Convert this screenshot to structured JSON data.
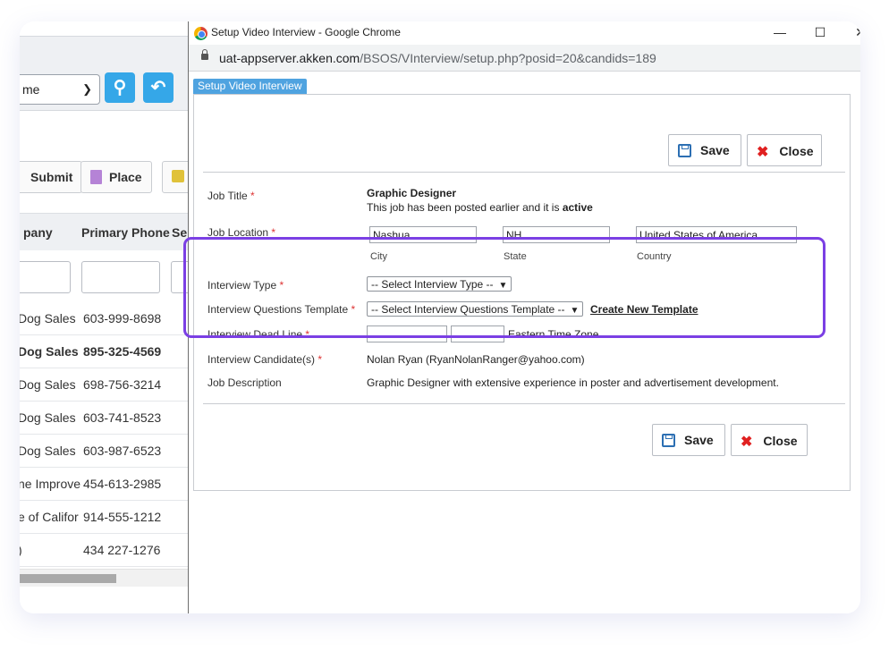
{
  "background_app": {
    "select_value": "me",
    "buttons": {
      "submit": "Submit",
      "place": "Place"
    },
    "columns": {
      "company": "pany",
      "primary_phone": "Primary Phone",
      "third": "Se"
    },
    "rows": [
      {
        "company": "Dog Sales",
        "phone": "603-999-8698",
        "bold": false
      },
      {
        "company": "Dog Sales",
        "phone": "895-325-4569",
        "bold": true
      },
      {
        "company": "Dog Sales",
        "phone": "698-756-3214",
        "bold": false
      },
      {
        "company": "Dog Sales",
        "phone": "603-741-8523",
        "bold": false
      },
      {
        "company": "Dog Sales",
        "phone": "603-987-6523",
        "bold": false
      },
      {
        "company": "ne Improve",
        "phone": "454-613-2985",
        "bold": false
      },
      {
        "company": "e of Califor",
        "phone": "914-555-1212",
        "bold": false
      },
      {
        "company": ")",
        "phone": "434 227-1276",
        "bold": false
      }
    ],
    "colors": {
      "icon_button": "#35a7e8"
    }
  },
  "window": {
    "title": "Setup Video Interview - Google Chrome",
    "controls": {
      "minimize": "—",
      "maximize": "☐",
      "close": "✕"
    },
    "url_host": "uat-appserver.akken.com",
    "url_path": "/BSOS/VInterview/setup.php?posid=20&candids=189"
  },
  "form": {
    "tab_label": "Setup Video Interview",
    "save_label": "Save",
    "close_label": "Close",
    "job_title": {
      "label": "Job Title",
      "value": "Graphic Designer",
      "note_prefix": "This job has been posted earlier and it is",
      "note_status": "active"
    },
    "job_location": {
      "label": "Job Location",
      "city": "Nashua",
      "state": "NH",
      "country": "United States of America",
      "city_label": "City",
      "state_label": "State",
      "country_label": "Country"
    },
    "interview_type": {
      "label": "Interview Type",
      "selected": "-- Select Interview Type --"
    },
    "questions_template": {
      "label": "Interview Questions Template",
      "selected": "-- Select Interview Questions Template --",
      "create_link": "Create New Template"
    },
    "dead_line": {
      "label": "Interview Dead Line",
      "date": "",
      "time": "",
      "timezone": "Eastern Time Zone"
    },
    "candidates": {
      "label": "Interview Candidate(s)",
      "value": "Nolan Ryan (RyanNolanRanger@yahoo.com)"
    },
    "job_description": {
      "label": "Job Description",
      "value": "Graphic Designer with extensive experience in poster and advertisement development."
    },
    "required_marker": "*"
  },
  "colors": {
    "tab": "#4fa3e0",
    "highlight": "#7b3fe4",
    "required": "#dd3333",
    "close_x": "#e02020"
  }
}
